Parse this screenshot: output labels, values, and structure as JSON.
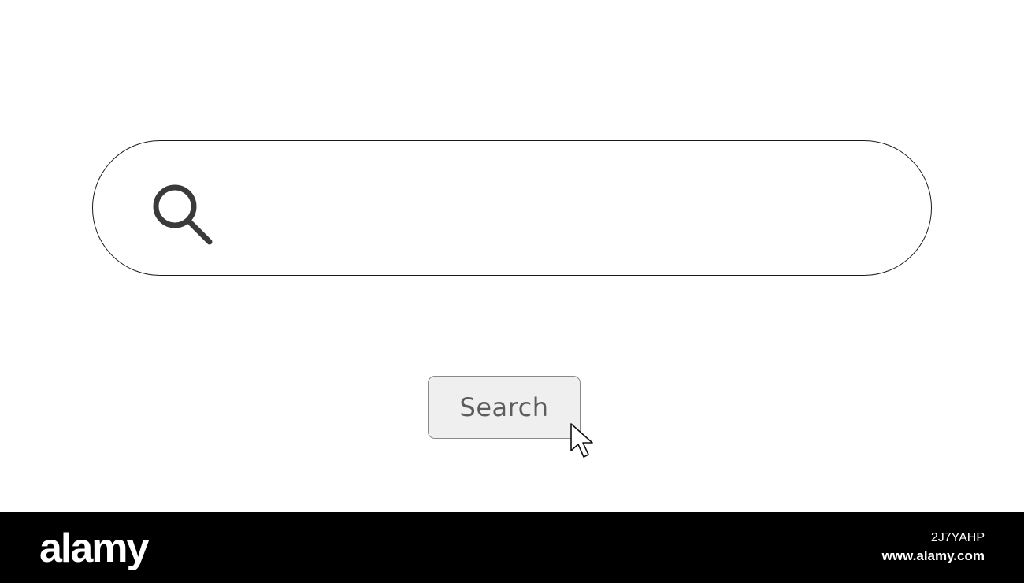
{
  "search": {
    "value": "",
    "placeholder": "",
    "icon": "search-icon"
  },
  "button": {
    "label": "Search"
  },
  "cursor": {
    "icon": "mouse-pointer-icon"
  },
  "watermark": {
    "brand": "alamy",
    "image_id": "2J7YAHP",
    "site": "www.alamy.com"
  },
  "colors": {
    "background": "#ffffff",
    "bar_border": "#1a1a1a",
    "icon": "#3a3a3a",
    "button_bg": "#efefef",
    "button_border": "#8a8a8a",
    "button_text": "#5c5c5c",
    "footer_bg": "#000000"
  }
}
